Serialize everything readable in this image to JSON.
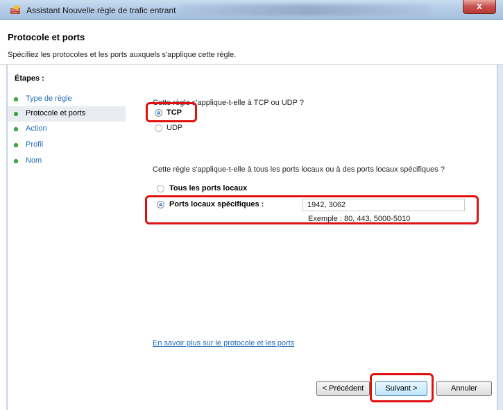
{
  "window": {
    "title": "Assistant Nouvelle règle de trafic entrant",
    "close_label": "x"
  },
  "header": {
    "title": "Protocole et ports",
    "subtitle": "Spécifiez les protocoles et les ports auxquels s'applique cette règle."
  },
  "sidebar": {
    "title": "Étapes :",
    "items": [
      {
        "label": "Type de règle"
      },
      {
        "label": "Protocole et ports"
      },
      {
        "label": "Action"
      },
      {
        "label": "Profil"
      },
      {
        "label": "Nom"
      }
    ]
  },
  "protocol": {
    "question": "Cette règle s'applique-t-elle à TCP ou UDP ?",
    "options": [
      {
        "label": "TCP",
        "selected": true
      },
      {
        "label": "UDP",
        "selected": false
      }
    ]
  },
  "ports": {
    "question": "Cette règle s'applique-t-elle à tous les ports locaux ou à des ports locaux spécifiques ?",
    "options": [
      {
        "label": "Tous les ports locaux",
        "selected": false
      },
      {
        "label": "Ports locaux spécifiques :",
        "selected": true
      }
    ],
    "value": "1942, 3062",
    "example": "Exemple : 80, 443, 5000-5010"
  },
  "help_link": "En savoir plus sur le protocole et les ports",
  "buttons": {
    "back": "< Précédent",
    "next": "Suivant >",
    "cancel": "Annuler"
  },
  "colors": {
    "highlight": "#e01010",
    "link": "#1f6ab4",
    "step_dot": "#3bb53b"
  }
}
